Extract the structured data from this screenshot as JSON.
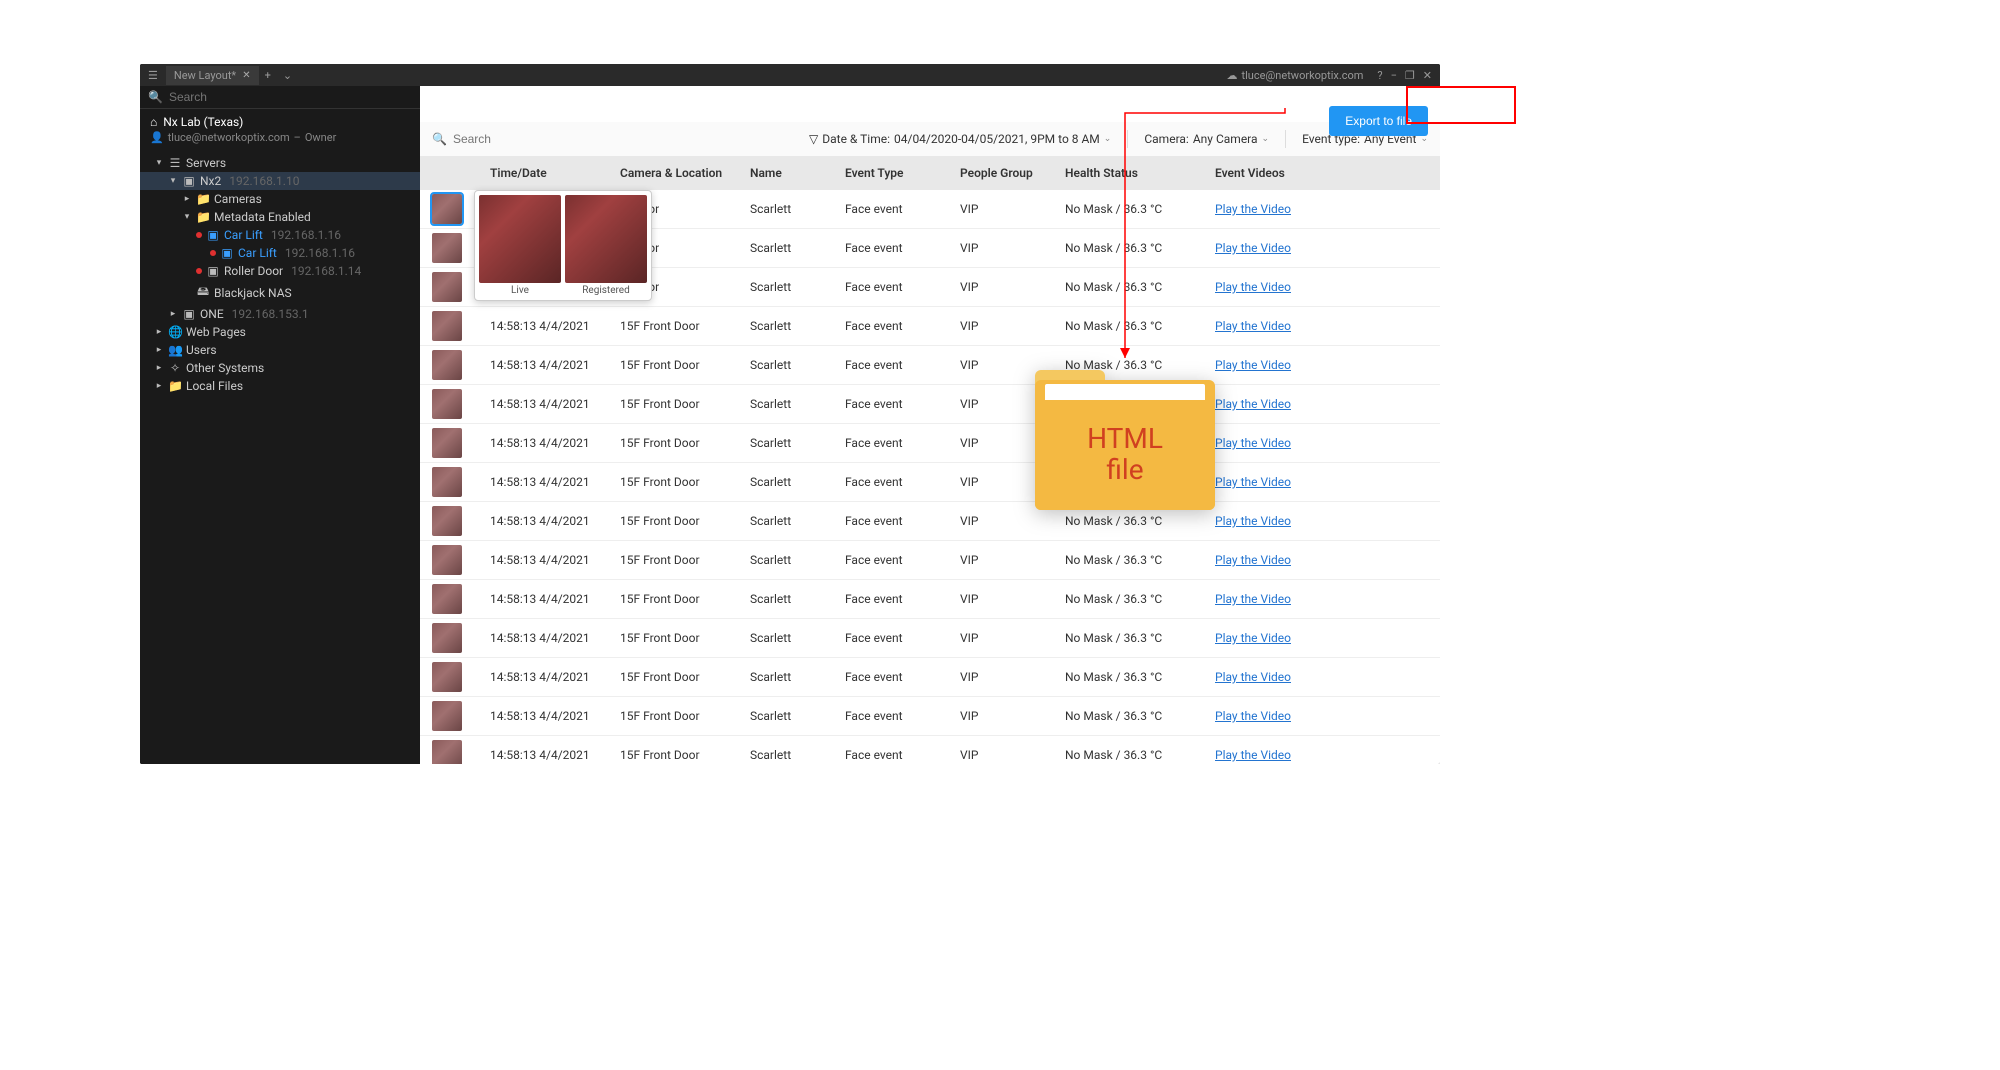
{
  "titlebar": {
    "tab_label": "New Layout*",
    "cloud_user": "tluce@networkoptix.com"
  },
  "sidebar": {
    "search_placeholder": "Search",
    "site_name": "Nx Lab (Texas)",
    "owner_email": "tluce@networkoptix.com",
    "owner_role": "Owner",
    "tree": {
      "servers": "Servers",
      "nx2": "Nx2",
      "nx2_ip": "192.168.1.10",
      "cameras": "Cameras",
      "metadata": "Metadata Enabled",
      "carlift1": "Car Lift",
      "carlift1_ip": "192.168.1.16",
      "carlift2": "Car Lift",
      "carlift2_ip": "192.168.1.16",
      "roller": "Roller Door",
      "roller_ip": "192.168.1.14",
      "blackjack": "Blackjack NAS",
      "one": "ONE",
      "one_ip": "192.168.153.1",
      "webpages": "Web Pages",
      "users": "Users",
      "other": "Other Systems",
      "local": "Local Files"
    }
  },
  "main": {
    "export_label": "Export to file",
    "search_placeholder": "Search",
    "filter_datetime_label": "Date & Time:",
    "filter_datetime_value": "04/04/2020-04/05/2021, 9PM to 8 AM",
    "filter_camera_label": "Camera:",
    "filter_camera_value": "Any Camera",
    "filter_event_label": "Event type:",
    "filter_event_value": "Any Event"
  },
  "columns": {
    "time": "Time/Date",
    "camera": "Camera & Location",
    "name": "Name",
    "event": "Event Type",
    "group": "People Group",
    "health": "Health Status",
    "video": "Event Videos"
  },
  "row": {
    "time": "14:58:13 4/4/2021",
    "camera": "15F Front Door",
    "camera_short": "nt Door",
    "name": "Scarlett",
    "event": "Face event",
    "group": "VIP",
    "health": "No Mask / 36.3 °C",
    "video": "Play the Video"
  },
  "preview": {
    "live": "Live",
    "registered": "Registered"
  },
  "overlay": {
    "folder_line1": "HTML",
    "folder_line2": "file"
  }
}
